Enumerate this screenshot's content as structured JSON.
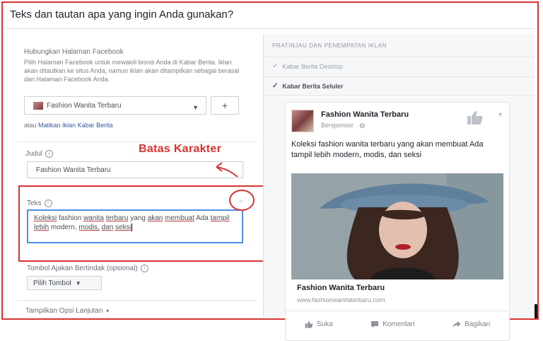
{
  "header": {
    "title": "Teks dan tautan apa yang ingin Anda gunakan?"
  },
  "left": {
    "connect_label": "Hubungkan Halaman Facebook",
    "connect_desc": "Pilih Halaman Facebook untuk mewakili bisnis Anda di Kabar Berita. Iklan akan ditautkan ke situs Anda, namun iklan akan ditampilkan sebagai berasal dari Halaman Facebook Anda.",
    "page_select": "Fashion Wanita Terbaru",
    "plus": "+",
    "turnoff_prefix": "atau",
    "turnoff_link": "Matikan Iklan Kabar Berita",
    "judul_label": "Judul",
    "judul_value": "Fashion Wanita Terbaru",
    "teks_label": "Teks",
    "teks_words": [
      "Koleksi",
      "fashion",
      "wanita",
      "terbaru",
      "yang",
      "akan",
      "membuat",
      "Ada",
      "tampil",
      "lebih",
      "modern,",
      "modis,",
      "dan",
      "seksi"
    ],
    "cta_label": "Tombol Ajakan Bertindak (opsional)",
    "cta_button": "Pilih Tombol",
    "advanced": "Tampilkan Opsi Lanjutan"
  },
  "annotation": {
    "text": "Batas Karakter"
  },
  "right": {
    "title": "PRATINJAU DAN PENEMPATAN IKLAN",
    "placement_desktop": "Kabar Berita Desktop",
    "placement_mobile": "Kabar Berita Seluler",
    "check": "✓"
  },
  "card": {
    "page_name": "Fashion Wanita Terbaru",
    "sponsored": "Bersponsor",
    "post_text": "Koleksi fashion wanita terbaru yang akan membuat Ada tampil lebih modern, modis, dan seksi",
    "link_title": "Fashion Wanita Terbaru",
    "link_url": "www.fashionwanitaterbaru.com",
    "actions": [
      "Suka",
      "Komentari",
      "Bagikan"
    ]
  },
  "colors": {
    "accent_red": "#d9332f",
    "link_blue": "#365899",
    "focus_blue": "#4a90e2"
  }
}
